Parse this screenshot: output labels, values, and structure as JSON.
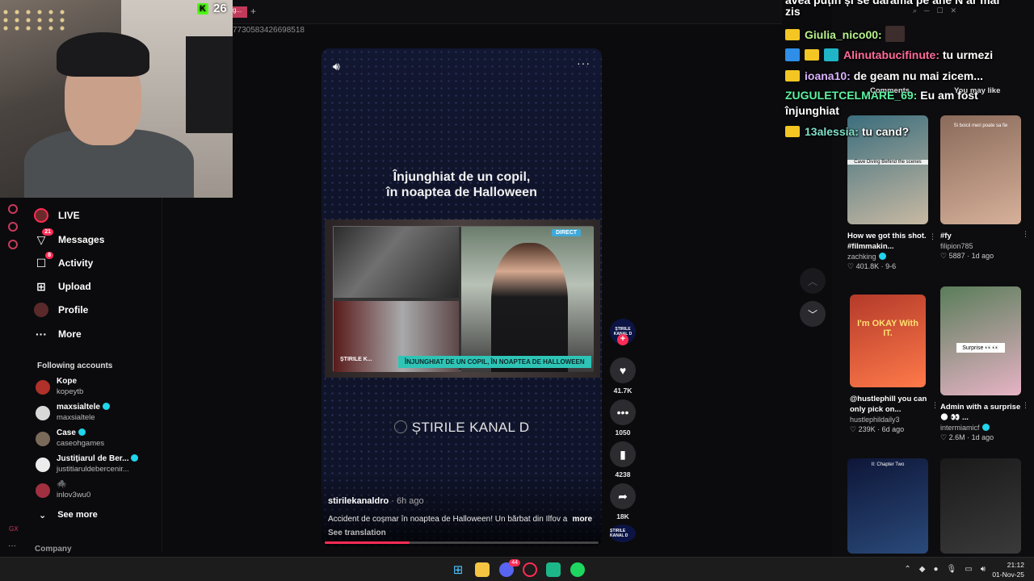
{
  "stream": {
    "viewer_count": "26"
  },
  "browser": {
    "url_fragment": "7730583426698518",
    "tab_fragment": "g..."
  },
  "sidebar": {
    "nav": [
      {
        "label": "LIVE",
        "icon": "live-avatar-icon"
      },
      {
        "label": "Messages",
        "icon": "messages-icon",
        "badge": "21"
      },
      {
        "label": "Activity",
        "icon": "activity-icon",
        "badge": "8"
      },
      {
        "label": "Upload",
        "icon": "upload-icon"
      },
      {
        "label": "Profile",
        "icon": "profile-avatar-icon"
      },
      {
        "label": "More",
        "icon": "more-dots-icon"
      }
    ],
    "following_title": "Following accounts",
    "accounts": [
      {
        "name": "Kope",
        "user": "kopeytb",
        "verified": false
      },
      {
        "name": "maxsialtele",
        "user": "maxsialtele",
        "verified": true
      },
      {
        "name": "Case",
        "user": "caseohgames",
        "verified": true
      },
      {
        "name": "Justițiarul de Ber...",
        "user": "justitiaruldebercenir...",
        "verified": true
      },
      {
        "name": "🕷️",
        "user": "inlov3wu0",
        "verified": false
      }
    ],
    "see_more": "See more",
    "company": "Company",
    "gx_label": "GX"
  },
  "video": {
    "headline_line1": "Înjunghiat de un copil,",
    "headline_line2": "în noaptea de Halloween",
    "direct_badge": "DIRECT",
    "lower_third": "ÎNJUNGHIAT DE UN COPIL, ÎN NOAPTEA DE HALLOWEEN",
    "frame_brand": "ȘTIRILE K...",
    "brand": "ȘTIRILE KANAL D",
    "author": "stirilekanaldro",
    "time_ago": " · 6h ago",
    "caption": "Accident de coșmar în noaptea de Halloween! Un bărbat din Ilfov a",
    "caption_more": "more",
    "see_translation": "See translation",
    "progress": 0.31
  },
  "actions": {
    "avatar_text": "ȘTIRILE KANAL D",
    "likes": "41.7K",
    "comments": "1050",
    "saves": "4238",
    "shares": "18K"
  },
  "right_panel": {
    "tabs": [
      "Comments",
      "You may like"
    ],
    "cards": [
      {
        "title": "How we got this shot. #filmmakin...",
        "user": "zachking",
        "verified": true,
        "stats": "♡ 401.8K · 9-6",
        "thumb_label": "Cave Diving Behind the scenes",
        "colors": [
          "#3b6e7d",
          "#c8b9a3"
        ]
      },
      {
        "title": "#fy",
        "user": "filipion785",
        "verified": false,
        "stats": "♡ 5887 · 1d ago",
        "thumb_label": "Si boicii meri poate sa fie",
        "colors": [
          "#8a6a5a",
          "#d6b09a"
        ]
      },
      {
        "title": "@hustlephill you can only pick on...",
        "user": "hustlephildaily3",
        "verified": false,
        "stats": "♡ 239K · 6d ago",
        "thumb_label": "I'm OKAY With IT.",
        "colors": [
          "#b43a2a",
          "#ff7a4a"
        ]
      },
      {
        "title": "Admin with a surprise 🌑 👀 ...",
        "user": "intermiamicf",
        "verified": true,
        "stats": "♡ 2.6M · 1d ago",
        "thumb_label": "Surprise 👀👀",
        "colors": [
          "#5a7d5a",
          "#e6b3c5"
        ]
      },
      {
        "title": "",
        "user": "",
        "verified": false,
        "stats": "",
        "thumb_label": "II: Chapter Two",
        "colors": [
          "#0e1638",
          "#2a4a7a"
        ]
      },
      {
        "title": "",
        "user": "",
        "verified": false,
        "stats": "",
        "thumb_label": "",
        "colors": [
          "#1a1a1a",
          "#3a3a3a"
        ]
      }
    ]
  },
  "chat": {
    "messages": [
      {
        "user": "",
        "text": "avea puțin și se dărâmă pe ăne N ar mai",
        "color": "#ffffff",
        "badges": []
      },
      {
        "user": "",
        "text": "zis",
        "color": "#ffffff",
        "badges": []
      },
      {
        "user": "Giulia_nico00:",
        "text": "",
        "color": "#b7f28a",
        "badges": [
          "crown"
        ],
        "avatar": true
      },
      {
        "user": "Alinutabucifinute:",
        "text": " tu urmezi",
        "color": "#ff6b9a",
        "badges": [
          "pin",
          "crown",
          "gg"
        ]
      },
      {
        "user": "ioana10:",
        "text": " de geam nu mai zicem...",
        "color": "#d9b3ff",
        "badges": [
          "crown"
        ]
      },
      {
        "user": "ZUGULETCELMARE_69:",
        "text": " Eu am fost",
        "color": "#5cf2a0",
        "badges": []
      },
      {
        "user": "",
        "text": "înjunghiat",
        "color": "#ffffff",
        "badges": []
      },
      {
        "user": "13alessia:",
        "text": " tu cand?",
        "color": "#7fe0c8",
        "badges": [
          "crown"
        ]
      }
    ]
  },
  "taskbar": {
    "icons": [
      "windows-start-icon",
      "file-explorer-icon",
      "discord-icon",
      "opera-gx-icon",
      "app-icon",
      "spotify-icon"
    ],
    "discord_badge": "44",
    "time": "21:12",
    "date": "01-Nov-25"
  },
  "colors": {
    "accent": "#fe2c55",
    "kick_green": "#53fc18",
    "verified": "#20d5ec"
  }
}
